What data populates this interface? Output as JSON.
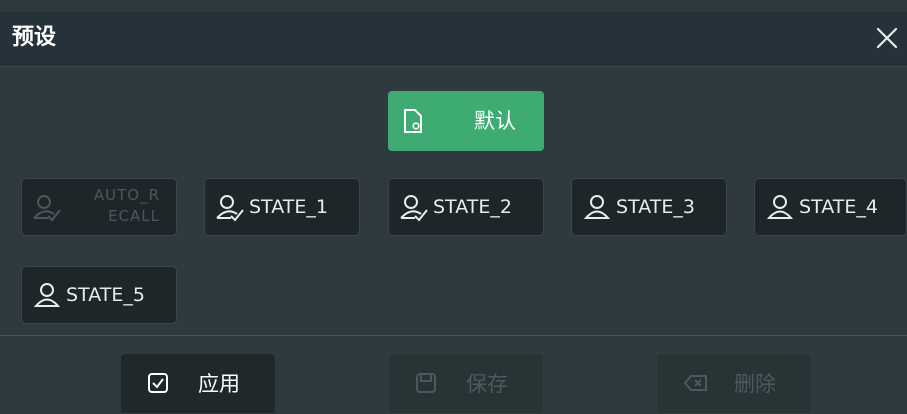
{
  "dialog": {
    "title": "预设",
    "close_icon": "close-icon"
  },
  "default_button": {
    "label": "默认",
    "icon": "document-settings-icon",
    "color": "#3dab72"
  },
  "states": [
    {
      "label": "AUTO_R\nECALL",
      "line1": "AUTO_R",
      "line2": "ECALL",
      "enabled": false,
      "icon": "user-check-icon"
    },
    {
      "label": "STATE_1",
      "enabled": true,
      "icon": "user-check-icon"
    },
    {
      "label": "STATE_2",
      "enabled": true,
      "icon": "user-check-icon"
    },
    {
      "label": "STATE_3",
      "enabled": true,
      "icon": "user-icon"
    },
    {
      "label": "STATE_4",
      "enabled": true,
      "icon": "user-icon"
    },
    {
      "label": "STATE_5",
      "enabled": true,
      "icon": "user-icon"
    }
  ],
  "actions": {
    "apply": {
      "label": "应用",
      "icon": "checkbox-icon",
      "enabled": true
    },
    "save": {
      "label": "保存",
      "icon": "floppy-disk-icon",
      "enabled": false
    },
    "delete": {
      "label": "删除",
      "icon": "backspace-icon",
      "enabled": false
    }
  }
}
